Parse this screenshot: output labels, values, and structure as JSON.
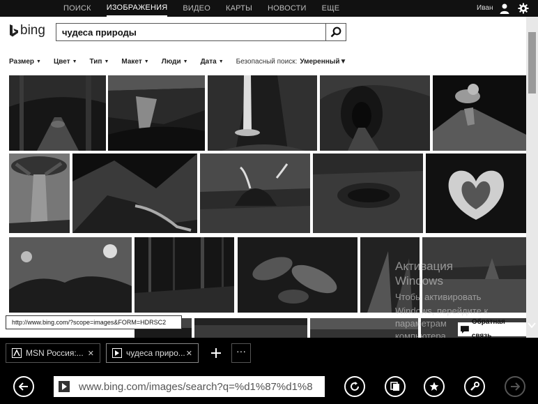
{
  "topnav": {
    "items": [
      {
        "label": "ПОИСК",
        "active": false
      },
      {
        "label": "ИЗОБРАЖЕНИЯ",
        "active": true
      },
      {
        "label": "ВИДЕО",
        "active": false
      },
      {
        "label": "КАРТЫ",
        "active": false
      },
      {
        "label": "НОВОСТИ",
        "active": false
      },
      {
        "label": "ЕЩЕ",
        "active": false
      }
    ],
    "user_name": "Иван",
    "user_icon": "person-icon",
    "settings_icon": "gear-icon"
  },
  "logo": {
    "text": "bing"
  },
  "search": {
    "query": "чудеса природы",
    "button_icon": "search-icon"
  },
  "filters": {
    "items": [
      "Размер",
      "Цвет",
      "Тип",
      "Макет",
      "Люди",
      "Дата"
    ],
    "safe_search_label": "Безопасный поиск:",
    "safe_search_value": "Умеренный"
  },
  "url_tooltip": "http://www.bing.com/?scope=images&FORM=HDRSC2",
  "watermark": {
    "title": "Активация",
    "line1": "Windows",
    "line2": "Чтобы активировать",
    "line3": "Windows, перейдите к",
    "line4": "параметрам",
    "line5": "компьютера."
  },
  "feedback_label": "Обратная связь",
  "tabs": [
    {
      "title": "MSN Россия:...",
      "close": "✕",
      "icon": "msn-icon"
    },
    {
      "title": "чудеса приро...",
      "close": "✕",
      "icon": "bing-icon"
    }
  ],
  "tab_menu_label": "···",
  "address": {
    "url": "www.bing.com/images/search?q=%d1%87%d1%8"
  },
  "colors": {
    "page_background": "#ffffff",
    "chrome_background": "#000000",
    "thumbnail_fill": "#111111"
  }
}
